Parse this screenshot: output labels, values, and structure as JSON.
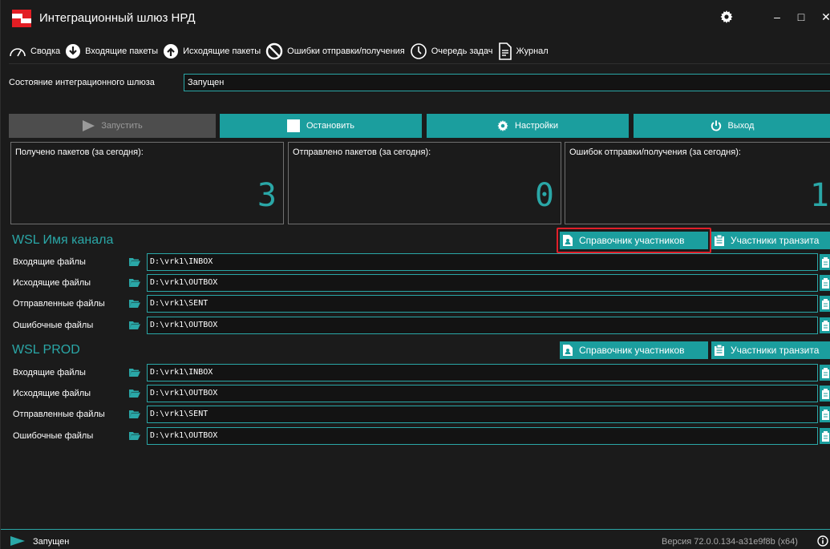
{
  "window": {
    "title": "Интеграционный шлюз НРД",
    "controls": {
      "minimize": "‒",
      "maximize": "□",
      "close": "✕"
    }
  },
  "tabs": [
    {
      "label": "Сводка",
      "icon": "gauge-icon",
      "active": true
    },
    {
      "label": "Входящие пакеты",
      "icon": "arrow-down-circle-icon"
    },
    {
      "label": "Исходящие пакеты",
      "icon": "arrow-up-circle-icon"
    },
    {
      "label": "Ошибки отправки/получения",
      "icon": "ban-icon"
    },
    {
      "label": "Очередь задач",
      "icon": "clock-icon"
    },
    {
      "label": "Журнал",
      "icon": "document-icon"
    }
  ],
  "gateway_status": {
    "label": "Состояние интеграционного шлюза",
    "value": "Запущен"
  },
  "actions": {
    "start": "Запустить",
    "stop": "Остановить",
    "settings": "Настройки",
    "exit": "Выход"
  },
  "counters": [
    {
      "label": "Получено пакетов (за сегодня):",
      "value": "3"
    },
    {
      "label": "Отправлено пакетов (за сегодня):",
      "value": "0"
    },
    {
      "label": "Ошибок отправки/получения (за сегодня):",
      "value": "1"
    }
  ],
  "channels": [
    {
      "title": "WSL Имя канала",
      "directory_button": "Справочник участников",
      "transit_button": "Участники транзита",
      "paths": [
        {
          "label": "Входящие файлы",
          "value": "D:\\vrk1\\INBOX"
        },
        {
          "label": "Исходящие файлы",
          "value": "D:\\vrk1\\OUTBOX"
        },
        {
          "label": "Отправленные файлы",
          "value": "D:\\vrk1\\SENT"
        },
        {
          "label": "Ошибочные файлы",
          "value": "D:\\vrk1\\OUTBOX"
        }
      ]
    },
    {
      "title": "WSL PROD",
      "directory_button": "Справочник участников",
      "transit_button": "Участники транзита",
      "paths": [
        {
          "label": "Входящие файлы",
          "value": "D:\\vrk1\\INBOX"
        },
        {
          "label": "Исходящие файлы",
          "value": "D:\\vrk1\\OUTBOX"
        },
        {
          "label": "Отправленные файлы",
          "value": "D:\\vrk1\\SENT"
        },
        {
          "label": "Ошибочные файлы",
          "value": "D:\\vrk1\\OUTBOX"
        }
      ]
    }
  ],
  "statusbar": {
    "state": "Запущен",
    "version": "Версия 72.0.0.134-a31e9f8b (x64)"
  },
  "colors": {
    "accent": "#1b9e9e",
    "accent_text": "#2aa7a7",
    "background": "#1b1b1b",
    "highlight": "#e0202a",
    "brand_red": "#e31e24"
  }
}
